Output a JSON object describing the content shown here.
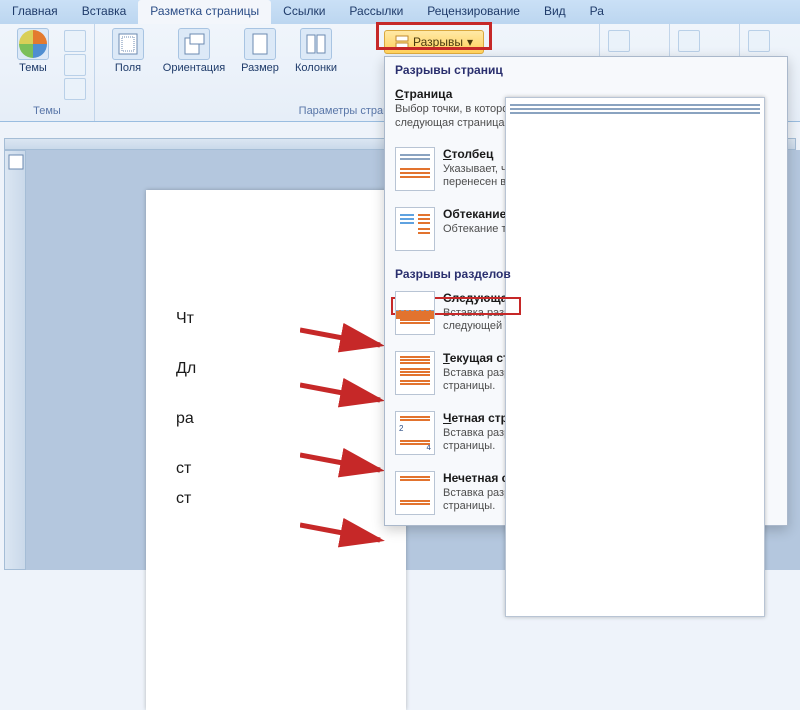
{
  "tabs": {
    "home": "Главная",
    "insert": "Вставка",
    "layout": "Разметка страницы",
    "references": "Ссылки",
    "mailings": "Рассылки",
    "review": "Рецензирование",
    "view": "Вид"
  },
  "ribbon": {
    "themes_group": "Темы",
    "themes_btn": "Темы",
    "page_setup_group": "Параметры страни",
    "margins": "Поля",
    "orientation": "Ориентация",
    "size": "Размер",
    "columns": "Колонки",
    "breaks_btn": "Разрывы"
  },
  "dropdown": {
    "page_breaks_head": "Разрывы страниц",
    "page": {
      "title_u": "С",
      "title_rest": "траница",
      "desc": "Выбор точки, в которой заканчивается одна страница и начинается следующая страница."
    },
    "column": {
      "title_u": "С",
      "title_rest": "толбец",
      "desc": "Указывает, что текст, следующий за разрывом колонки, будет перенесен в начало следующей колонки."
    },
    "wrap": {
      "title": "Обтекание текстом",
      "desc": "Обтекание текста вокруг объектов на веб-страницах."
    },
    "section_breaks_head": "Разрывы разделов",
    "next": {
      "title": "Следующая страница",
      "desc": "Вставка разрыва раздела и начало нового раздела со следующей страницы."
    },
    "continuous": {
      "title_u": "Т",
      "title_rest": "екущая страница",
      "desc": "Вставка разрыва раздела и начало нового раздела с той же страницы."
    },
    "even": {
      "title_u": "Ч",
      "title_rest": "етная страница",
      "desc": "Вставка разрыва раздела и начало нового раздела с четной страницы."
    },
    "odd": {
      "title": "Нечетная страница",
      "desc": "Вставка разрыва раздела и начало нового раздела с нечетной страницы."
    },
    "badge2": "2",
    "badge4": "4"
  },
  "doc": {
    "l1": "Чт",
    "l2": "Дл",
    "l3": "ра",
    "l4": "ст",
    "l5": "ст"
  }
}
